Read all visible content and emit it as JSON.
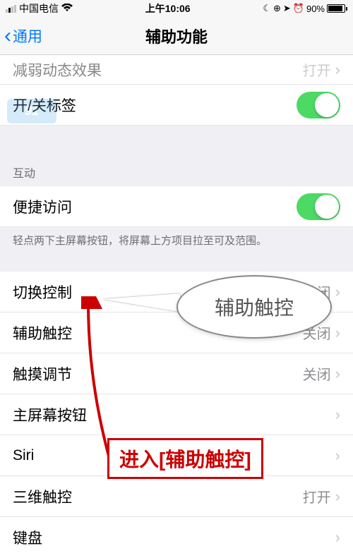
{
  "status": {
    "carrier": "中国电信",
    "time": "上午10:06",
    "battery_pct": "90%"
  },
  "nav": {
    "back_label": "通用",
    "title": "辅助功能"
  },
  "cut_row": {
    "label": "减弱动态效果",
    "value": "打开"
  },
  "labels_toggle": {
    "label": "开/关标签"
  },
  "section_interaction": {
    "header": "互动"
  },
  "reachability": {
    "label": "便捷访问",
    "footer": "轻点两下主屏幕按钮，将屏幕上方项目拉至可及范围。"
  },
  "rows": {
    "switch_control": {
      "label": "切换控制",
      "value": "关闭"
    },
    "assistive_touch": {
      "label": "辅助触控",
      "value": "关闭"
    },
    "touch_accom": {
      "label": "触摸调节",
      "value": "关闭"
    },
    "home_button": {
      "label": "主屏幕按钮"
    },
    "siri": {
      "label": "Siri"
    },
    "three_d": {
      "label": "三维触控",
      "value": "打开"
    },
    "keyboard": {
      "label": "键盘"
    }
  },
  "callout_text": "辅助触控",
  "instruction_text": "进入[辅助触控]",
  "watermark_text": "91"
}
